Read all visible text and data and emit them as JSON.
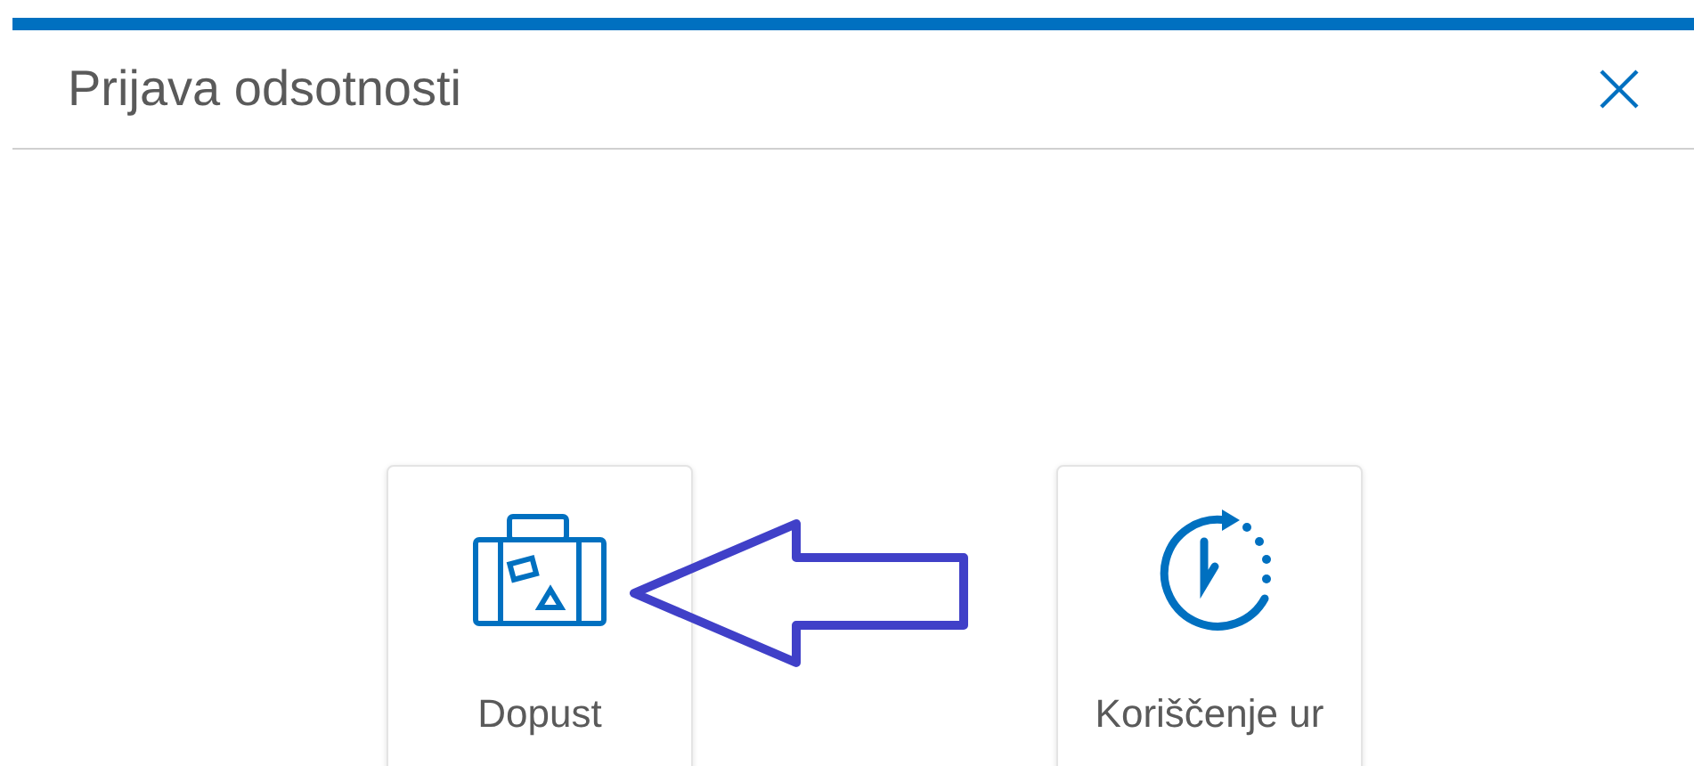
{
  "dialog": {
    "title": "Prijava odsotnosti"
  },
  "options": [
    {
      "kind": "suitcase",
      "label": "Dopust"
    },
    {
      "kind": "timer",
      "label": "Koriščenje ur"
    }
  ]
}
